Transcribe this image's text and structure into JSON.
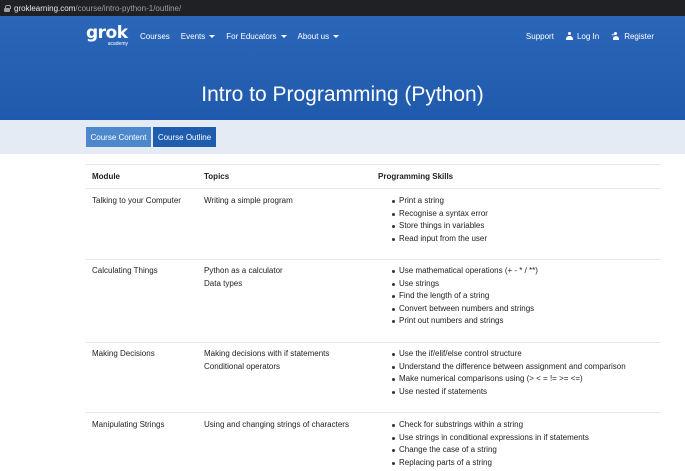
{
  "browser": {
    "url_domain": "groklearning.com",
    "url_path": "/course/intro-python-1/outline/"
  },
  "nav": {
    "logo_word": "grok",
    "logo_sub": "academy",
    "items": [
      {
        "label": "Courses",
        "dropdown": false
      },
      {
        "label": "Events",
        "dropdown": true
      },
      {
        "label": "For Educators",
        "dropdown": true
      },
      {
        "label": "About us",
        "dropdown": true
      }
    ],
    "support": "Support",
    "login": "Log In",
    "register": "Register"
  },
  "hero": {
    "title": "Intro to Programming (Python)"
  },
  "tabs": {
    "content": "Course Content",
    "outline": "Course Outline"
  },
  "table": {
    "headers": {
      "module": "Module",
      "topics": "Topics",
      "skills": "Programming Skills"
    },
    "rows": [
      {
        "module": "Talking to your Computer",
        "topics": [
          "Writing a simple program"
        ],
        "skills": [
          "Print a string",
          "Recognise a syntax error",
          "Store things in variables",
          "Read input from the user"
        ]
      },
      {
        "module": "Calculating Things",
        "topics": [
          "Python as a calculator",
          "Data types"
        ],
        "skills": [
          "Use mathematical operations (+ - * / **)",
          "Use strings",
          "Find the length of a string",
          "Convert between numbers and strings",
          "Print out numbers and strings"
        ]
      },
      {
        "module": "Making Decisions",
        "topics": [
          "Making decisions with if statements",
          "Conditional operators"
        ],
        "skills": [
          "Use the if/elif/else control structure",
          "Understand the difference between assignment and comparison",
          "Make numerical comparisons using (> < = != >= <=)",
          "Use nested if statements"
        ]
      },
      {
        "module": "Manipulating Strings",
        "topics": [
          "Using and changing strings of characters"
        ],
        "skills": [
          "Check for substrings within a string",
          "Use strings in conditional expressions in if statements",
          "Change the case of a string",
          "Replacing parts of a string"
        ]
      }
    ]
  },
  "colors": {
    "hero_blue": "#2b66b8",
    "tab_light": "#4d87cc",
    "tab_dark": "#1e5dae",
    "band": "#e4ebf4"
  }
}
